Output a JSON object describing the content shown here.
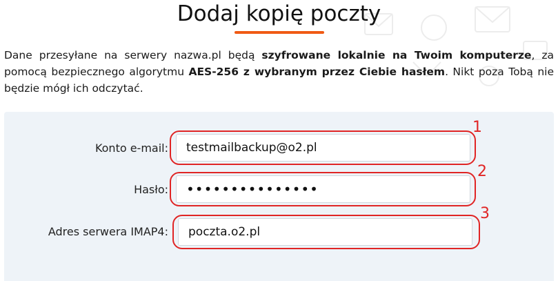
{
  "page": {
    "title": "Dodaj kopię poczty",
    "intro": {
      "part1": "Dane przesyłane na serwery nazwa.pl będą ",
      "bold1": "szyfrowane lokalnie na Twoim komputerze",
      "part2": ", za pomocą bezpiecznego algorytmu ",
      "bold2": "AES-256 z wybranym przez Ciebie hasłem",
      "part3": ". Nikt poza Tobą nie będzie mógł ich odczytać."
    }
  },
  "form": {
    "email_label": "Konto e-mail:",
    "email_value": "testmailbackup@o2.pl",
    "password_label": "Hasło:",
    "password_masked": "•••••••••••••••",
    "imap_label": "Adres serwera IMAP4:",
    "imap_value": "poczta.o2.pl"
  },
  "annotations": {
    "n1": "1",
    "n2": "2",
    "n3": "3"
  },
  "colors": {
    "accent": "#f05a14",
    "annotation": "#e02424",
    "panel": "#eef3f8"
  }
}
